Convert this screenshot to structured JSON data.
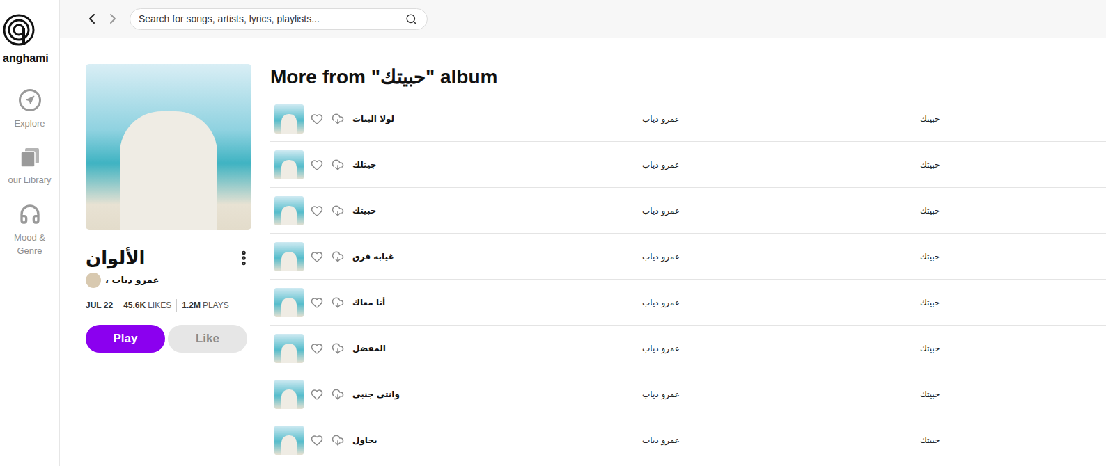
{
  "logo": {
    "text": "anghami"
  },
  "sidebar": {
    "items": [
      {
        "label": "Explore",
        "selected": false,
        "kind": "explore"
      },
      {
        "label": "our Library",
        "selected": false,
        "kind": "library"
      },
      {
        "label": "Mood & Genre",
        "selected": false,
        "kind": "mood"
      }
    ]
  },
  "search": {
    "placeholder": "Search for songs, artists, lyrics, playlists..."
  },
  "album": {
    "title": "الألوان",
    "artist": "، عمرو دياب",
    "date": "JUL 22",
    "likes": "45.6K",
    "likes_label": "LIKES",
    "plays": "1.2M",
    "plays_label": "PLAYS",
    "play_button": "Play",
    "like_button": "Like"
  },
  "more": {
    "heading": "More from \"حبيتك\" album"
  },
  "tracks": [
    {
      "title": "لولا البنات",
      "artist": "عمرو دياب",
      "album": "حبيتك",
      "liked": false
    },
    {
      "title": "جيتلك",
      "artist": "عمرو دياب",
      "album": "حبيتك",
      "liked": false
    },
    {
      "title": "حبيتك",
      "artist": "عمرو دياب",
      "album": "حبيتك",
      "liked": false
    },
    {
      "title": "غيابه فرق",
      "artist": "عمرو دياب",
      "album": "حبيتك",
      "liked": false
    },
    {
      "title": "أنا معاك",
      "artist": "عمرو دياب",
      "album": "حبيتك",
      "liked": false
    },
    {
      "title": "المفضل",
      "artist": "عمرو دياب",
      "album": "حبيتك",
      "liked": false
    },
    {
      "title": "وانتي جنبي",
      "artist": "عمرو دياب",
      "album": "حبيتك",
      "liked": false
    },
    {
      "title": "بحاول",
      "artist": "عمرو دياب",
      "album": "حبيتك",
      "liked": false
    }
  ]
}
